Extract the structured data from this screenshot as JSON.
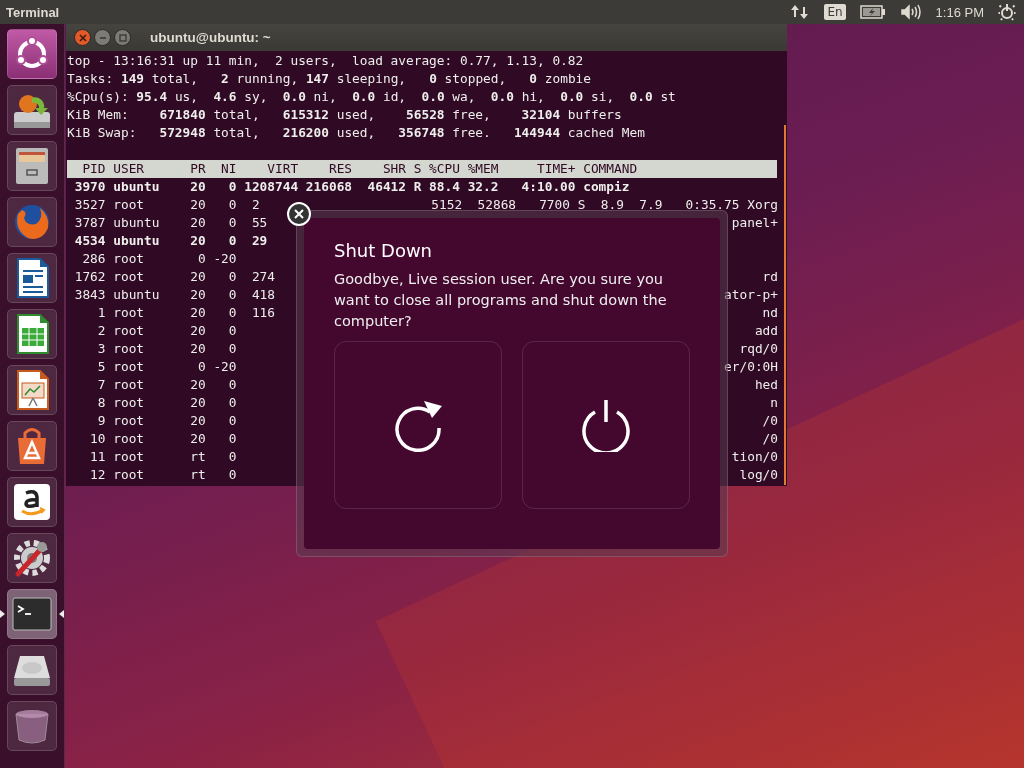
{
  "top_panel": {
    "app_title": "Terminal",
    "language": "En",
    "clock": "1:16 PM"
  },
  "launcher": [
    {
      "kind": "dash",
      "active": false
    },
    {
      "kind": "installer",
      "active": false
    },
    {
      "kind": "files",
      "active": false
    },
    {
      "kind": "browser",
      "active": false
    },
    {
      "kind": "writer",
      "active": false
    },
    {
      "kind": "calc",
      "active": false
    },
    {
      "kind": "impress",
      "active": false
    },
    {
      "kind": "software",
      "active": false
    },
    {
      "kind": "shop",
      "active": false
    },
    {
      "kind": "settings",
      "active": false
    },
    {
      "kind": "terminal",
      "active": true
    },
    {
      "kind": "drive",
      "active": false
    },
    {
      "kind": "trash",
      "active": false
    }
  ],
  "terminal": {
    "title": "ubuntu@ubuntu: ~",
    "summary": [
      "top - 13:16:31 up 11 min,  2 users,  load average: 0.77, 1.13, 0.82",
      "Tasks: **149** total,   **2** running, **147** sleeping,   **0** stopped,   **0** zombie",
      "%Cpu(s): **95.4** us,  **4.6** sy,  **0.0** ni,  **0.0** id,  **0.0** wa,  **0.0** hi,  **0.0** si,  **0.0** st",
      "KiB Mem:    **671840** total,   **615312** used,    **56528** free,    **32104** buffers",
      "KiB Swap:   **572948** total,   **216200** used,   **356748** free.   **144944** cached Mem"
    ],
    "header": "  PID USER      PR  NI    VIRT    RES    SHR S %CPU %MEM     TIME+ COMMAND",
    "rows": [
      {
        "left": " 3970 ubuntu    20   0 1208744 216068  46412 R 88.4 32.2   4:10.00 compiz",
        "right": "",
        "bold": true
      },
      {
        "left": " 3527 root      20   0  2",
        "right": "5152  52868   7700 S  8.9  7.9   0:35.75 Xorg",
        "bold": false
      },
      {
        "left": " 3787 ubuntu    20   0  55",
        "right": "panel+",
        "bold": false
      },
      {
        "left": " 4534 ubuntu    20   0  29",
        "right": "",
        "bold": true
      },
      {
        "left": "  286 root       0 -20",
        "right": "",
        "bold": false
      },
      {
        "left": " 1762 root      20   0  274",
        "right": "rd",
        "bold": false
      },
      {
        "left": " 3843 ubuntu    20   0  418",
        "right": "ator-p+",
        "bold": false
      },
      {
        "left": "    1 root      20   0  116",
        "right": "nd",
        "bold": false
      },
      {
        "left": "    2 root      20   0",
        "right": "add",
        "bold": false
      },
      {
        "left": "    3 root      20   0",
        "right": "rqd/0",
        "bold": false
      },
      {
        "left": "    5 root       0 -20",
        "right": "er/0:0H",
        "bold": false
      },
      {
        "left": "    7 root      20   0",
        "right": "hed",
        "bold": false
      },
      {
        "left": "    8 root      20   0",
        "right": "n",
        "bold": false
      },
      {
        "left": "    9 root      20   0",
        "right": "/0",
        "bold": false
      },
      {
        "left": "   10 root      20   0",
        "right": "/0",
        "bold": false
      },
      {
        "left": "   11 root      rt   0",
        "right": "tion/0",
        "bold": false
      },
      {
        "left": "   12 root      rt   0",
        "right": "log/0",
        "bold": false
      }
    ]
  },
  "dialog": {
    "title": "Shut Down",
    "message": "Goodbye, Live session user. Are you sure you want to close all programs and shut down the computer?",
    "buttons": [
      {
        "kind": "restart"
      },
      {
        "kind": "shutdown"
      }
    ]
  }
}
